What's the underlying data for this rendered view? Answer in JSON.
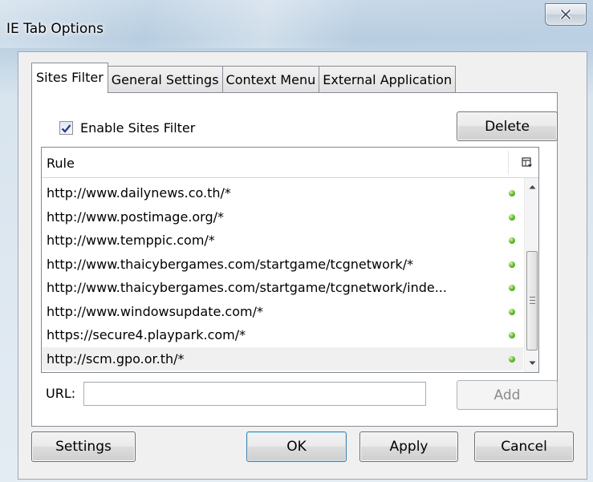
{
  "window": {
    "title": "IE Tab Options"
  },
  "tabs": [
    {
      "label": "Sites Filter",
      "active": true
    },
    {
      "label": "General Settings",
      "active": false
    },
    {
      "label": "Context Menu",
      "active": false
    },
    {
      "label": "External Application",
      "active": false
    }
  ],
  "sites_filter": {
    "enable_label": "Enable Sites Filter",
    "enable_checked": true,
    "delete_label": "Delete",
    "column_header": "Rule",
    "rules": [
      "http://www.dailynews.co.th/*",
      "http://www.postimage.org/*",
      "http://www.temppic.com/*",
      "http://www.thaicybergames.com/startgame/tcgnetwork/*",
      "http://www.thaicybergames.com/startgame/tcgnetwork/inde...",
      "http://www.windowsupdate.com/*",
      "https://secure4.playpark.com/*",
      "http://scm.gpo.or.th/*"
    ],
    "selected_index": 7,
    "url_label": "URL:",
    "url_value": "",
    "add_label": "Add"
  },
  "footer": {
    "settings_label": "Settings",
    "ok_label": "OK",
    "apply_label": "Apply",
    "cancel_label": "Cancel"
  },
  "icons": {
    "close": "close-icon",
    "column_picker": "column-picker-icon",
    "rule_enabled": "green-dot-icon",
    "checkbox": "checkmark-icon"
  }
}
